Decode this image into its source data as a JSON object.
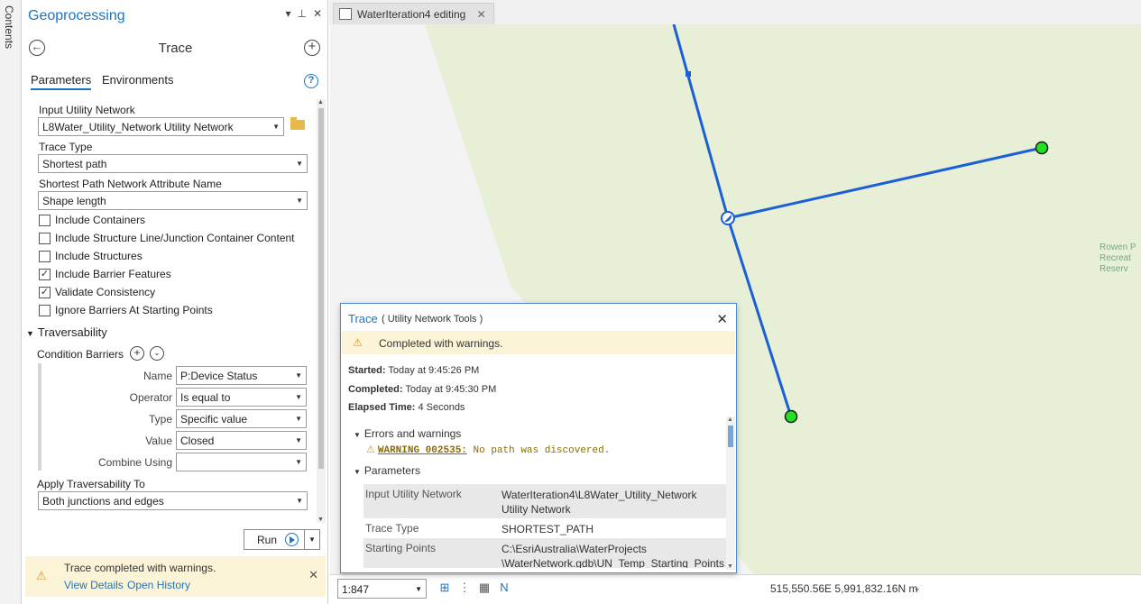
{
  "contents_tab": {
    "label": "Contents"
  },
  "geoprocessing": {
    "pane_title": "Geoprocessing",
    "tool_name": "Trace",
    "tabs": {
      "parameters": "Parameters",
      "environments": "Environments"
    },
    "input_network": {
      "label": "Input Utility Network",
      "value": "L8Water_Utility_Network Utility Network"
    },
    "trace_type": {
      "label": "Trace Type",
      "value": "Shortest path"
    },
    "shortest_path_attr": {
      "label": "Shortest Path Network Attribute Name",
      "value": "Shape length"
    },
    "checkboxes": [
      {
        "label": "Include Containers",
        "checked": false
      },
      {
        "label": "Include Structure Line/Junction Container Content",
        "checked": false
      },
      {
        "label": "Include Structures",
        "checked": false
      },
      {
        "label": "Include Barrier Features",
        "checked": true
      },
      {
        "label": "Validate Consistency",
        "checked": true
      },
      {
        "label": "Ignore Barriers At Starting Points",
        "checked": false
      }
    ],
    "traversability": {
      "heading": "Traversability",
      "condition_barriers_label": "Condition Barriers",
      "name": {
        "label": "Name",
        "value": "P:Device Status"
      },
      "operator": {
        "label": "Operator",
        "value": "Is equal to"
      },
      "type": {
        "label": "Type",
        "value": "Specific value"
      },
      "value": {
        "label": "Value",
        "value": "Closed"
      },
      "combine_using": {
        "label": "Combine Using",
        "value": ""
      },
      "apply_to": {
        "label": "Apply Traversability To",
        "value": "Both junctions and edges"
      }
    },
    "run_label": "Run",
    "message": {
      "text": "Trace completed with warnings.",
      "view_details": "View Details",
      "open_history": "Open History"
    }
  },
  "map": {
    "tab_title": "WaterIteration4 editing",
    "park_label": [
      "Rowen P",
      "Recreat",
      "Reserv"
    ],
    "scale": "1:847",
    "coordinates": "515,550.56E 5,991,832.16N m"
  },
  "popup": {
    "title": "Trace",
    "subtitle": "( Utility Network Tools )",
    "status": "Completed with warnings.",
    "started_label": "Started:",
    "started_value": "Today at 9:45:26 PM",
    "completed_label": "Completed:",
    "completed_value": "Today at 9:45:30 PM",
    "elapsed_label": "Elapsed Time:",
    "elapsed_value": "4 Seconds",
    "errors_heading": "Errors and warnings",
    "warning_code": "WARNING 002535:",
    "warning_text": "No path was discovered.",
    "parameters_heading": "Parameters",
    "params": [
      {
        "key": "Input Utility Network",
        "value": "WaterIteration4\\L8Water_Utility_Network Utility Network"
      },
      {
        "key": "Trace Type",
        "value": "SHORTEST_PATH"
      },
      {
        "key": "Starting Points",
        "value": "C:\\EsriAustralia\\WaterProjects \\WaterNetwork.gdb\\UN_Temp_Starting_Points"
      }
    ]
  },
  "colors": {
    "accent": "#1d74c4",
    "map_land": "#e7efd6",
    "map_water_line": "#1a5fd6",
    "point_green": "#22e022",
    "warning_bg": "#fcf4d6",
    "warning_icon": "#d8911c"
  }
}
